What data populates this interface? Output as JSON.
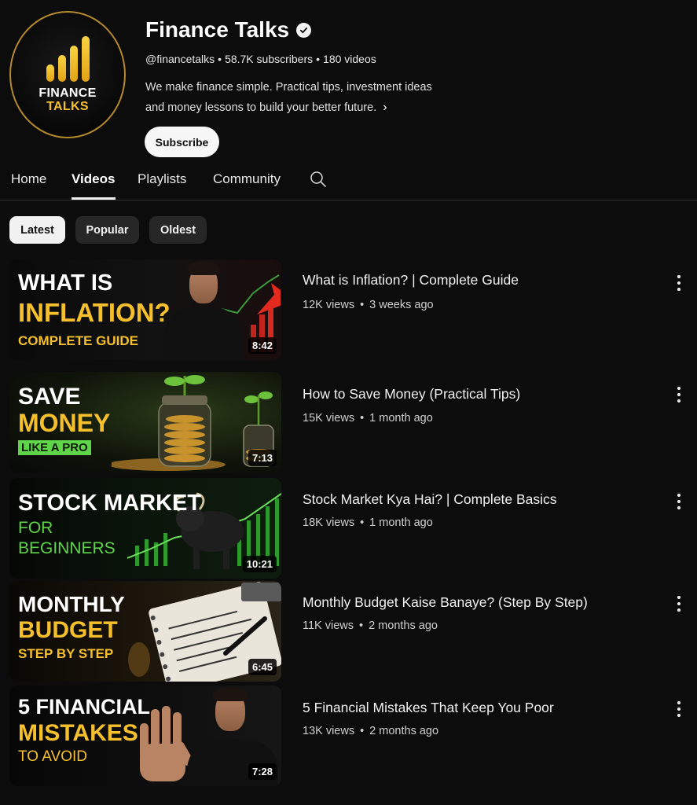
{
  "channel": {
    "logo_line1": "FINANCE",
    "logo_line2": "TALKS",
    "name": "Finance Talks",
    "handle": "@financetalks",
    "subscribers": "58.7K subscribers",
    "videos_count": "180 videos",
    "description_line1": "We make finance simple. Practical tips, investment ideas",
    "description_line2": "and money lessons to build your better future.",
    "more_icon": "chevron-right-icon",
    "verified_icon": "verified-check-icon",
    "subscribe_label": "Subscribe"
  },
  "tabs": [
    {
      "label": "Home",
      "active": false
    },
    {
      "label": "Videos",
      "active": true
    },
    {
      "label": "Playlists",
      "active": false
    },
    {
      "label": "Community",
      "active": false
    }
  ],
  "search_icon": "search-icon",
  "sort_chips": [
    {
      "label": "Latest",
      "active": true
    },
    {
      "label": "Popular",
      "active": false
    },
    {
      "label": "Oldest",
      "active": false
    }
  ],
  "videos": [
    {
      "thumb_line1": "WHAT IS",
      "thumb_line2": "INFLATION?",
      "thumb_line3": "COMPLETE GUIDE",
      "duration": "8:42",
      "title": "What is Inflation? | Complete Guide",
      "views": "12K views",
      "age": "3 weeks ago"
    },
    {
      "thumb_line1": "SAVE",
      "thumb_line2": "MONEY",
      "thumb_line3": "LIKE A PRO",
      "duration": "7:13",
      "title": "How to Save Money (Practical Tips)",
      "views": "15K views",
      "age": "1 month ago"
    },
    {
      "thumb_line1": "STOCK MARKET",
      "thumb_line2": "FOR",
      "thumb_line3": "BEGINNERS",
      "duration": "10:21",
      "title": "Stock Market Kya Hai? | Complete Basics",
      "views": "18K views",
      "age": "1 month ago"
    },
    {
      "thumb_line1": "MONTHLY",
      "thumb_line2": "BUDGET",
      "thumb_line3": "STEP BY STEP",
      "duration": "6:45",
      "title": "Monthly Budget Kaise Banaye? (Step By Step)",
      "views": "11K views",
      "age": "2 months ago"
    },
    {
      "thumb_line1": "5 FINANCIAL",
      "thumb_line2": "MISTAKES",
      "thumb_line3": "TO AVOID",
      "duration": "7:28",
      "title": "5 Financial Mistakes That Keep You Poor",
      "views": "13K views",
      "age": "2 months ago"
    }
  ],
  "colors": {
    "background": "#0c0c0c",
    "accent_gold": "#f5c02c",
    "accent_green": "#5fd64a"
  }
}
